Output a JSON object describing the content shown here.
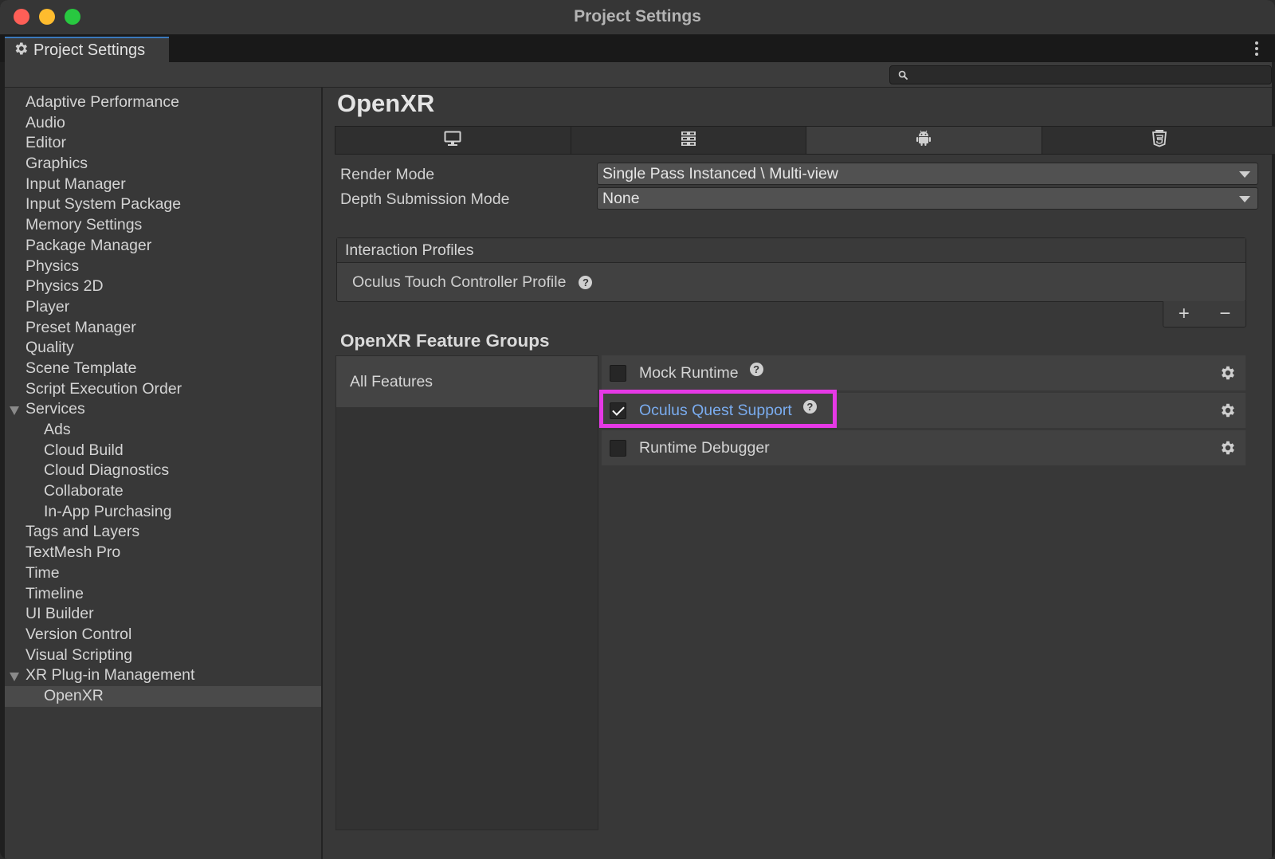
{
  "window": {
    "title": "Project Settings"
  },
  "tab": {
    "label": "Project Settings",
    "icon": "gear-icon"
  },
  "search": {
    "placeholder": "",
    "icon": "search-icon"
  },
  "sidebar": {
    "items": [
      {
        "label": "Adaptive Performance",
        "level": 0
      },
      {
        "label": "Audio",
        "level": 0
      },
      {
        "label": "Editor",
        "level": 0
      },
      {
        "label": "Graphics",
        "level": 0
      },
      {
        "label": "Input Manager",
        "level": 0
      },
      {
        "label": "Input System Package",
        "level": 0
      },
      {
        "label": "Memory Settings",
        "level": 0
      },
      {
        "label": "Package Manager",
        "level": 0
      },
      {
        "label": "Physics",
        "level": 0
      },
      {
        "label": "Physics 2D",
        "level": 0
      },
      {
        "label": "Player",
        "level": 0
      },
      {
        "label": "Preset Manager",
        "level": 0
      },
      {
        "label": "Quality",
        "level": 0
      },
      {
        "label": "Scene Template",
        "level": 0
      },
      {
        "label": "Script Execution Order",
        "level": 0
      },
      {
        "label": "Services",
        "level": 0,
        "expanded": true
      },
      {
        "label": "Ads",
        "level": 1
      },
      {
        "label": "Cloud Build",
        "level": 1
      },
      {
        "label": "Cloud Diagnostics",
        "level": 1
      },
      {
        "label": "Collaborate",
        "level": 1
      },
      {
        "label": "In-App Purchasing",
        "level": 1
      },
      {
        "label": "Tags and Layers",
        "level": 0
      },
      {
        "label": "TextMesh Pro",
        "level": 0
      },
      {
        "label": "Time",
        "level": 0
      },
      {
        "label": "Timeline",
        "level": 0
      },
      {
        "label": "UI Builder",
        "level": 0
      },
      {
        "label": "Version Control",
        "level": 0
      },
      {
        "label": "Visual Scripting",
        "level": 0
      },
      {
        "label": "XR Plug-in Management",
        "level": 0,
        "expanded": true
      },
      {
        "label": "OpenXR",
        "level": 1,
        "selected": true
      }
    ]
  },
  "main": {
    "title": "OpenXR",
    "platform_tabs": [
      {
        "icon": "desktop-icon",
        "active": false
      },
      {
        "icon": "server-icon",
        "active": false
      },
      {
        "icon": "android-icon",
        "active": true
      },
      {
        "icon": "html5-icon",
        "active": false
      }
    ],
    "render_mode": {
      "label": "Render Mode",
      "value": "Single Pass Instanced \\ Multi-view"
    },
    "depth_submission": {
      "label": "Depth Submission Mode",
      "value": "None"
    },
    "interaction_profiles": {
      "header": "Interaction Profiles",
      "items": [
        {
          "label": "Oculus Touch Controller Profile"
        }
      ],
      "add_label": "+",
      "remove_label": "−"
    },
    "feature_groups_title": "OpenXR Feature Groups",
    "groups": [
      {
        "label": "All Features"
      }
    ],
    "features": [
      {
        "label": "Mock Runtime",
        "checked": false,
        "help": true
      },
      {
        "label": "Oculus Quest Support",
        "checked": true,
        "help": true,
        "highlighted": true
      },
      {
        "label": "Runtime Debugger",
        "checked": false,
        "help": false
      }
    ]
  },
  "colors": {
    "highlight": "#e639e6",
    "link": "#7aacef",
    "accent": "#3a79bb"
  }
}
